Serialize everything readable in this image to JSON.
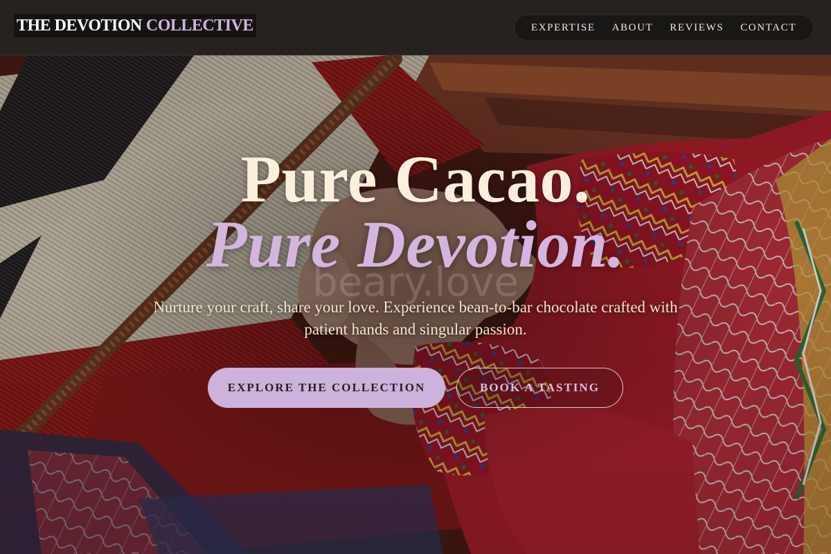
{
  "header": {
    "brand_main": "THE DEVOTION",
    "brand_accent": "COLLECTIVE",
    "nav": [
      {
        "label": "EXPERTISE"
      },
      {
        "label": "ABOUT"
      },
      {
        "label": "REVIEWS"
      },
      {
        "label": "CONTACT"
      }
    ]
  },
  "hero": {
    "headline_line1": "Pure Cacao.",
    "headline_line2": "Pure Devotion.",
    "watermark": "beary.love",
    "subtitle": "Nurture your craft, share your love. Experience bean-to-bar chocolate crafted with patient hands and singular passion.",
    "primary_button": "EXPLORE THE COLLECTION",
    "secondary_button": "BOOK A TASTING"
  },
  "colors": {
    "accent_lavender": "#d3b5de",
    "cream": "#fbf0db",
    "header_bg": "#262220",
    "button_primary_bg": "#cdb2dc"
  }
}
